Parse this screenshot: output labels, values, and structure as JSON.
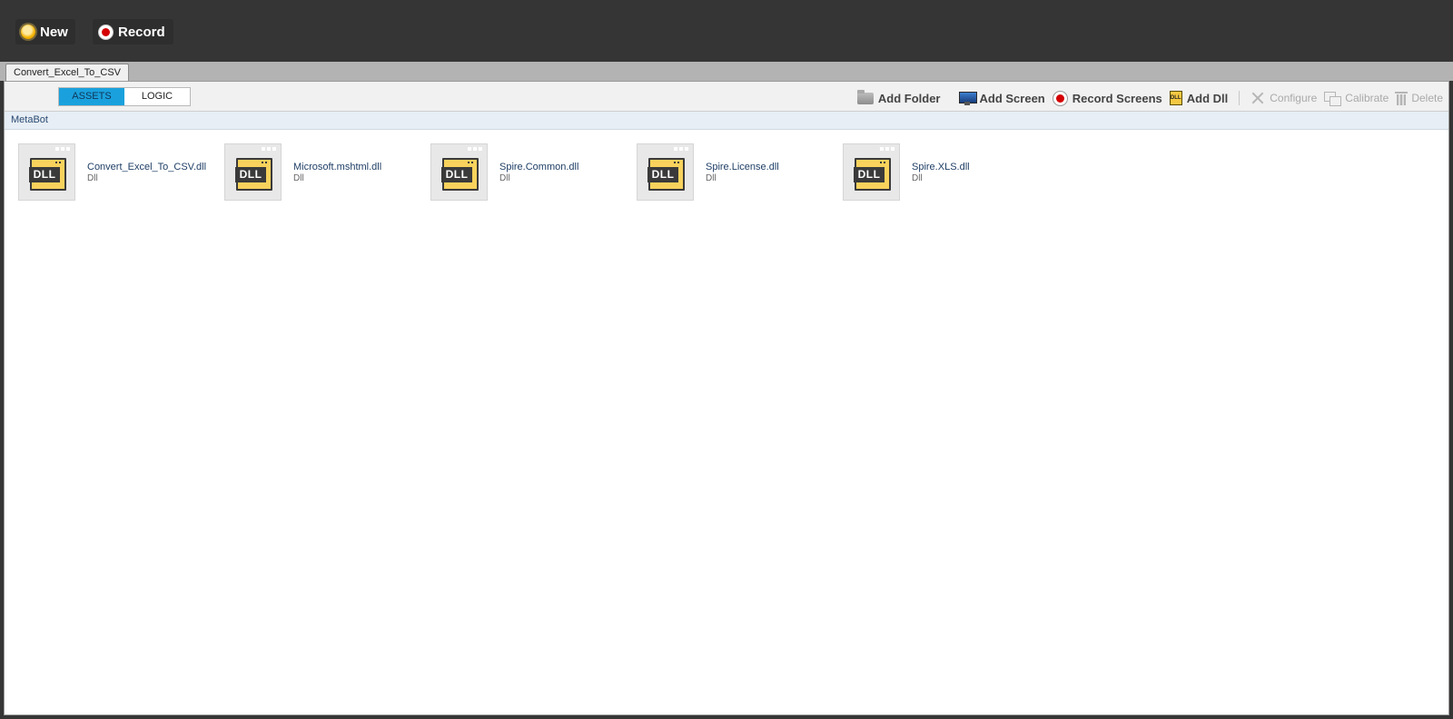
{
  "topbar": {
    "new_label": "New",
    "record_label": "Record"
  },
  "tab": {
    "label": "Convert_Excel_To_CSV"
  },
  "toolbar": {
    "assets_label": "ASSETS",
    "logic_label": "LOGIC",
    "add_folder": "Add Folder",
    "add_screen": "Add Screen",
    "record_screens": "Record Screens",
    "add_dll": "Add Dll",
    "configure": "Configure",
    "calibrate": "Calibrate",
    "delete": "Delete"
  },
  "breadcrumb": "MetaBot",
  "assets": [
    {
      "name": "Convert_Excel_To_CSV.dll",
      "type": "Dll",
      "icon_text": "DLL"
    },
    {
      "name": "Microsoft.mshtml.dll",
      "type": "Dll",
      "icon_text": "DLL"
    },
    {
      "name": "Spire.Common.dll",
      "type": "Dll",
      "icon_text": "DLL"
    },
    {
      "name": "Spire.License.dll",
      "type": "Dll",
      "icon_text": "DLL"
    },
    {
      "name": "Spire.XLS.dll",
      "type": "Dll",
      "icon_text": "DLL"
    }
  ],
  "colors": {
    "active_segment": "#1aa1dd",
    "top_bar": "#353535",
    "dll_icon": "#f8d25c",
    "record_red": "#d40000"
  }
}
